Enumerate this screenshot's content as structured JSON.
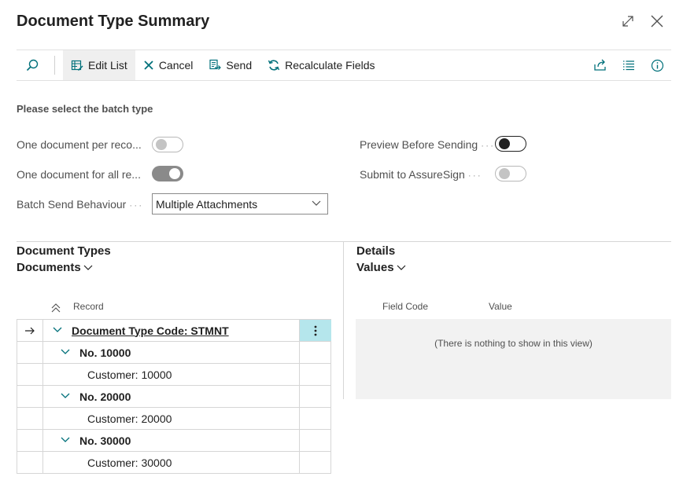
{
  "title": "Document Type Summary",
  "toolbar": {
    "edit_list": "Edit List",
    "cancel": "Cancel",
    "send": "Send",
    "recalculate": "Recalculate Fields"
  },
  "options": {
    "section_title": "Please select the batch type",
    "one_per_record": {
      "label": "One document per reco...",
      "value": false
    },
    "one_for_all": {
      "label": "One document for all re...",
      "value": true
    },
    "batch_send_behaviour": {
      "label": "Batch Send Behaviour",
      "value": "Multiple Attachments"
    },
    "preview_before_sending": {
      "label": "Preview Before Sending",
      "value": false
    },
    "submit_to_assuresign": {
      "label": "Submit to AssureSign",
      "value": false
    }
  },
  "left_part": {
    "title": "Document Types",
    "view": "Documents",
    "column_record": "Record",
    "rows": [
      {
        "text": "Document Type Code: STMNT",
        "level": 0
      },
      {
        "text": "No. 10000",
        "level": 1
      },
      {
        "text": "Customer: 10000",
        "level": 2
      },
      {
        "text": "No. 20000",
        "level": 1
      },
      {
        "text": "Customer: 20000",
        "level": 2
      },
      {
        "text": "No. 30000",
        "level": 1
      },
      {
        "text": "Customer: 30000",
        "level": 2
      }
    ]
  },
  "right_part": {
    "title": "Details",
    "view": "Values",
    "column_field_code": "Field Code",
    "column_value": "Value",
    "empty_message": "(There is nothing to show in this view)"
  },
  "colors": {
    "accent": "#00707a",
    "selected_cell": "#b5e6ec"
  }
}
